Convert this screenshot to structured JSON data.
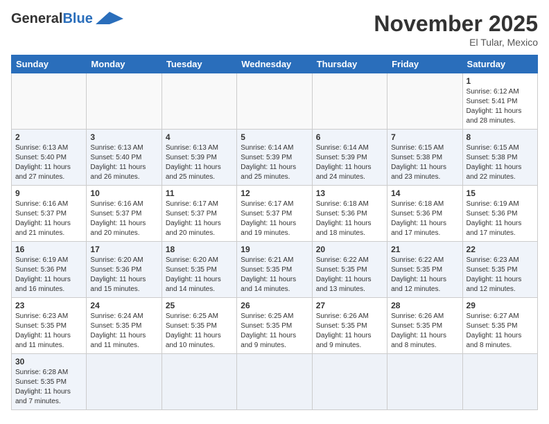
{
  "header": {
    "logo_general": "General",
    "logo_blue": "Blue",
    "month_title": "November 2025",
    "location": "El Tular, Mexico"
  },
  "weekdays": [
    "Sunday",
    "Monday",
    "Tuesday",
    "Wednesday",
    "Thursday",
    "Friday",
    "Saturday"
  ],
  "weeks": [
    [
      {
        "day": "",
        "info": ""
      },
      {
        "day": "",
        "info": ""
      },
      {
        "day": "",
        "info": ""
      },
      {
        "day": "",
        "info": ""
      },
      {
        "day": "",
        "info": ""
      },
      {
        "day": "",
        "info": ""
      },
      {
        "day": "1",
        "info": "Sunrise: 6:12 AM\nSunset: 5:41 PM\nDaylight: 11 hours\nand 28 minutes."
      }
    ],
    [
      {
        "day": "2",
        "info": "Sunrise: 6:13 AM\nSunset: 5:40 PM\nDaylight: 11 hours\nand 27 minutes."
      },
      {
        "day": "3",
        "info": "Sunrise: 6:13 AM\nSunset: 5:40 PM\nDaylight: 11 hours\nand 26 minutes."
      },
      {
        "day": "4",
        "info": "Sunrise: 6:13 AM\nSunset: 5:39 PM\nDaylight: 11 hours\nand 25 minutes."
      },
      {
        "day": "5",
        "info": "Sunrise: 6:14 AM\nSunset: 5:39 PM\nDaylight: 11 hours\nand 25 minutes."
      },
      {
        "day": "6",
        "info": "Sunrise: 6:14 AM\nSunset: 5:39 PM\nDaylight: 11 hours\nand 24 minutes."
      },
      {
        "day": "7",
        "info": "Sunrise: 6:15 AM\nSunset: 5:38 PM\nDaylight: 11 hours\nand 23 minutes."
      },
      {
        "day": "8",
        "info": "Sunrise: 6:15 AM\nSunset: 5:38 PM\nDaylight: 11 hours\nand 22 minutes."
      }
    ],
    [
      {
        "day": "9",
        "info": "Sunrise: 6:16 AM\nSunset: 5:37 PM\nDaylight: 11 hours\nand 21 minutes."
      },
      {
        "day": "10",
        "info": "Sunrise: 6:16 AM\nSunset: 5:37 PM\nDaylight: 11 hours\nand 20 minutes."
      },
      {
        "day": "11",
        "info": "Sunrise: 6:17 AM\nSunset: 5:37 PM\nDaylight: 11 hours\nand 20 minutes."
      },
      {
        "day": "12",
        "info": "Sunrise: 6:17 AM\nSunset: 5:37 PM\nDaylight: 11 hours\nand 19 minutes."
      },
      {
        "day": "13",
        "info": "Sunrise: 6:18 AM\nSunset: 5:36 PM\nDaylight: 11 hours\nand 18 minutes."
      },
      {
        "day": "14",
        "info": "Sunrise: 6:18 AM\nSunset: 5:36 PM\nDaylight: 11 hours\nand 17 minutes."
      },
      {
        "day": "15",
        "info": "Sunrise: 6:19 AM\nSunset: 5:36 PM\nDaylight: 11 hours\nand 17 minutes."
      }
    ],
    [
      {
        "day": "16",
        "info": "Sunrise: 6:19 AM\nSunset: 5:36 PM\nDaylight: 11 hours\nand 16 minutes."
      },
      {
        "day": "17",
        "info": "Sunrise: 6:20 AM\nSunset: 5:36 PM\nDaylight: 11 hours\nand 15 minutes."
      },
      {
        "day": "18",
        "info": "Sunrise: 6:20 AM\nSunset: 5:35 PM\nDaylight: 11 hours\nand 14 minutes."
      },
      {
        "day": "19",
        "info": "Sunrise: 6:21 AM\nSunset: 5:35 PM\nDaylight: 11 hours\nand 14 minutes."
      },
      {
        "day": "20",
        "info": "Sunrise: 6:22 AM\nSunset: 5:35 PM\nDaylight: 11 hours\nand 13 minutes."
      },
      {
        "day": "21",
        "info": "Sunrise: 6:22 AM\nSunset: 5:35 PM\nDaylight: 11 hours\nand 12 minutes."
      },
      {
        "day": "22",
        "info": "Sunrise: 6:23 AM\nSunset: 5:35 PM\nDaylight: 11 hours\nand 12 minutes."
      }
    ],
    [
      {
        "day": "23",
        "info": "Sunrise: 6:23 AM\nSunset: 5:35 PM\nDaylight: 11 hours\nand 11 minutes."
      },
      {
        "day": "24",
        "info": "Sunrise: 6:24 AM\nSunset: 5:35 PM\nDaylight: 11 hours\nand 11 minutes."
      },
      {
        "day": "25",
        "info": "Sunrise: 6:25 AM\nSunset: 5:35 PM\nDaylight: 11 hours\nand 10 minutes."
      },
      {
        "day": "26",
        "info": "Sunrise: 6:25 AM\nSunset: 5:35 PM\nDaylight: 11 hours\nand 9 minutes."
      },
      {
        "day": "27",
        "info": "Sunrise: 6:26 AM\nSunset: 5:35 PM\nDaylight: 11 hours\nand 9 minutes."
      },
      {
        "day": "28",
        "info": "Sunrise: 6:26 AM\nSunset: 5:35 PM\nDaylight: 11 hours\nand 8 minutes."
      },
      {
        "day": "29",
        "info": "Sunrise: 6:27 AM\nSunset: 5:35 PM\nDaylight: 11 hours\nand 8 minutes."
      }
    ],
    [
      {
        "day": "30",
        "info": "Sunrise: 6:28 AM\nSunset: 5:35 PM\nDaylight: 11 hours\nand 7 minutes."
      },
      {
        "day": "",
        "info": ""
      },
      {
        "day": "",
        "info": ""
      },
      {
        "day": "",
        "info": ""
      },
      {
        "day": "",
        "info": ""
      },
      {
        "day": "",
        "info": ""
      },
      {
        "day": "",
        "info": ""
      }
    ]
  ]
}
